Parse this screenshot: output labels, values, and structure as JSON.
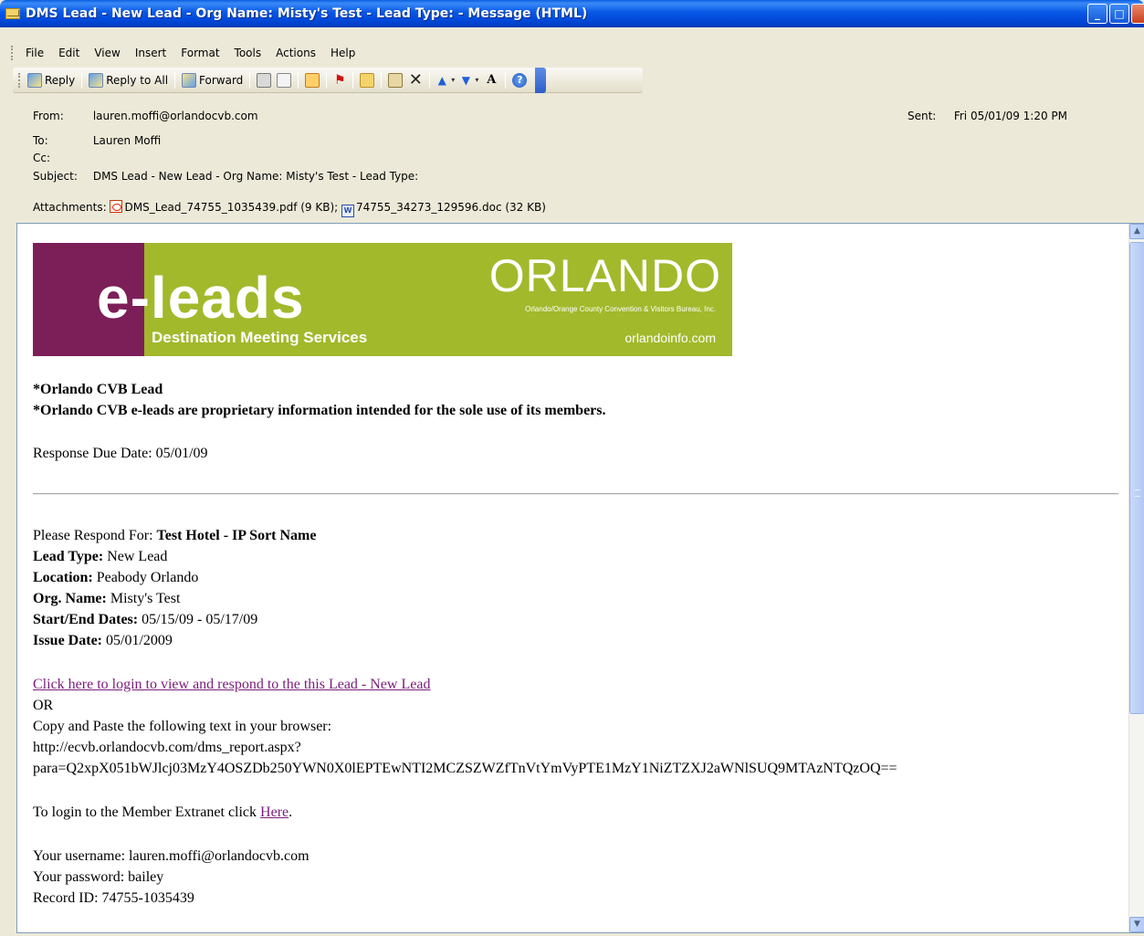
{
  "window": {
    "title": "DMS Lead - New Lead - Org Name: Misty's Test - Lead Type:  - Message (HTML)"
  },
  "menu": [
    "File",
    "Edit",
    "View",
    "Insert",
    "Format",
    "Tools",
    "Actions",
    "Help"
  ],
  "toolbar": {
    "reply": "Reply",
    "reply_all": "Reply to All",
    "forward": "Forward"
  },
  "header": {
    "from_label": "From:",
    "from": "lauren.moffi@orlandocvb.com",
    "sent_label": "Sent:",
    "sent": "Fri 05/01/09 1:20 PM",
    "to_label": "To:",
    "to": "Lauren Moffi",
    "cc_label": "Cc:",
    "cc": "",
    "subject_label": "Subject:",
    "subject": "DMS Lead - New Lead - Org Name: Misty's Test - Lead Type:",
    "attachments_label": "Attachments:",
    "attachments": [
      {
        "name": "DMS_Lead_74755_1035439.pdf (9 KB);",
        "icon": "pdf-icon"
      },
      {
        "name": "74755_34273_129596.doc (32 KB)",
        "icon": "word-doc-icon"
      }
    ]
  },
  "banner": {
    "brand": "e-leads",
    "tagline": "Destination Meeting Services",
    "org": "ORLANDO",
    "org_full": "Orlando/Orange County Convention & Visitors Bureau, Inc.",
    "url": "orlandoinfo.com",
    "colors": {
      "left": "#7c1e58",
      "right": "#a2b92c"
    }
  },
  "body": {
    "notice1": "*Orlando CVB Lead",
    "notice2": "*Orlando CVB e-leads are proprietary information intended for the sole use of its members.",
    "response_due": "Response Due Date: 05/01/09",
    "respond_for_label": "Please Respond For: ",
    "respond_for": "Test Hotel - IP Sort Name",
    "lead_type_label": "Lead Type:",
    "lead_type": " New Lead",
    "location_label": "Location:",
    "location": " Peabody Orlando",
    "org_label": "Org. Name:",
    "org": " Misty's Test",
    "dates_label": "Start/End Dates:",
    "dates": " 05/15/09 - 05/17/09",
    "issue_label": "Issue Date:",
    "issue": " 05/01/2009",
    "login_link": "Click here to login to view and respond to the this Lead - New Lead",
    "or": "OR",
    "copy_paste": "Copy and Paste the following text in your browser:",
    "url1": "http://ecvb.orlandocvb.com/dms_report.aspx?",
    "url2": "para=Q2xpX051bWJlcj03MzY4OSZDb250YWN0X0lEPTEwNTI2MCZSZWZfTnVtYmVyPTE1MzY1NiZTZXJ2aWNlSUQ9MTAzNTQzOQ==",
    "extranet_prefix": "To login to the Member Extranet click ",
    "extranet_link": "Here",
    "extranet_suffix": ".",
    "username": "Your username: lauren.moffi@orlandocvb.com",
    "password": "Your password: bailey",
    "record": "Record ID: 74755-1035439"
  }
}
